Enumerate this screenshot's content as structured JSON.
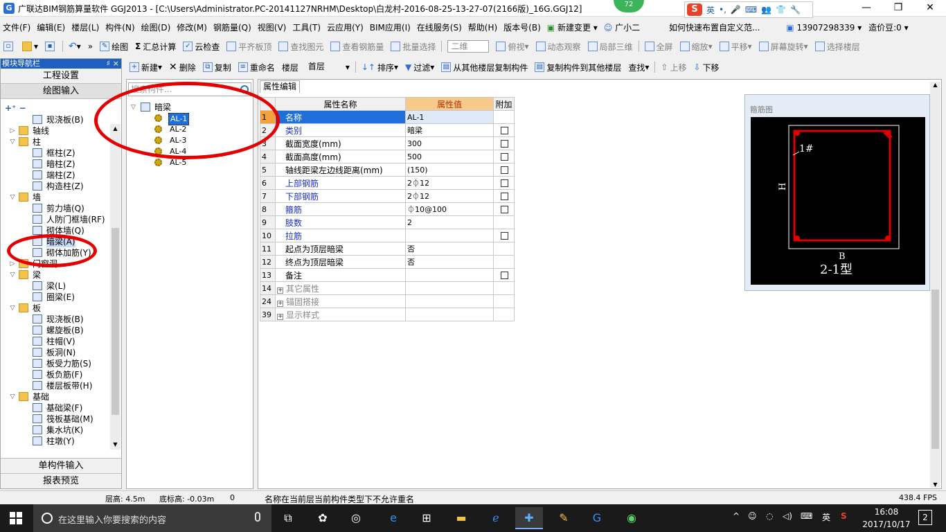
{
  "app": {
    "title": "广联达BIM钢筋算量软件 GGJ2013 - [C:\\Users\\Administrator.PC-20141127NRHM\\Desktop\\白龙村-2016-08-25-13-27-07(2166版)_16G.GGJ12]",
    "badge": "72",
    "ime_lang": "英",
    "win_buttons": [
      "—",
      "❐",
      "✕"
    ]
  },
  "menu": {
    "items": [
      "文件(F)",
      "编辑(E)",
      "楼层(L)",
      "构件(N)",
      "绘图(D)",
      "修改(M)",
      "钢筋量(Q)",
      "视图(V)",
      "工具(T)",
      "云应用(Y)",
      "BIM应用(I)",
      "在线服务(S)",
      "帮助(H)",
      "版本号(B)",
      "新建变更",
      "广小二"
    ],
    "help_link": "如何快速布置自定义范...",
    "phone": "13907298339",
    "price": "造价豆:0"
  },
  "toolbar": {
    "draw": "绘图",
    "sum": "汇总计算",
    "cloud_check": "云检查",
    "flat_top": "平齐板顶",
    "find_elem": "查找图元",
    "view_rebar": "查看钢筋量",
    "batch_select": "批量选择",
    "view2d": "二维",
    "top_view": "俯视",
    "dynamic": "动态观察",
    "local3d": "局部三维",
    "fullscreen": "全屏",
    "zoom": "缩放",
    "pan": "平移",
    "rotate": "屏幕旋转",
    "select_floor": "选择楼层"
  },
  "left_panel": {
    "title": "模块导航栏",
    "pin": "♯",
    "close": "×",
    "btn_settings": "工程设置",
    "btn_draw_input": "绘图输入",
    "btn_single": "单构件输入",
    "btn_report": "报表预览",
    "tree": [
      {
        "label": "现浇板(B)",
        "level": 2
      },
      {
        "label": "轴线",
        "level": 0,
        "folder": true,
        "collapsed": true
      },
      {
        "label": "柱",
        "level": 0,
        "folder": true
      },
      {
        "label": "框柱(Z)",
        "level": 2
      },
      {
        "label": "暗柱(Z)",
        "level": 2
      },
      {
        "label": "端柱(Z)",
        "level": 2
      },
      {
        "label": "构造柱(Z)",
        "level": 2
      },
      {
        "label": "墙",
        "level": 0,
        "folder": true
      },
      {
        "label": "剪力墙(Q)",
        "level": 2
      },
      {
        "label": "人防门框墙(RF)",
        "level": 2
      },
      {
        "label": "砌体墙(Q)",
        "level": 2
      },
      {
        "label": "暗梁(A)",
        "level": 2,
        "selected": true
      },
      {
        "label": "砌体加筋(Y)",
        "level": 2
      },
      {
        "label": "门窗洞",
        "level": 0,
        "folder": true,
        "collapsed": true
      },
      {
        "label": "梁",
        "level": 0,
        "folder": true
      },
      {
        "label": "梁(L)",
        "level": 2
      },
      {
        "label": "圈梁(E)",
        "level": 2
      },
      {
        "label": "板",
        "level": 0,
        "folder": true
      },
      {
        "label": "现浇板(B)",
        "level": 2
      },
      {
        "label": "螺旋板(B)",
        "level": 2
      },
      {
        "label": "柱帽(V)",
        "level": 2
      },
      {
        "label": "板洞(N)",
        "level": 2
      },
      {
        "label": "板受力筋(S)",
        "level": 2
      },
      {
        "label": "板负筋(F)",
        "level": 2
      },
      {
        "label": "楼层板带(H)",
        "level": 2
      },
      {
        "label": "基础",
        "level": 0,
        "folder": true
      },
      {
        "label": "基础梁(F)",
        "level": 2
      },
      {
        "label": "筏板基础(M)",
        "level": 2
      },
      {
        "label": "集水坑(K)",
        "level": 2
      },
      {
        "label": "柱墩(Y)",
        "level": 2
      }
    ]
  },
  "comp_toolbar": {
    "new": "新建",
    "delete": "删除",
    "copy": "复制",
    "rename": "重命名",
    "floor_label": "楼层",
    "floor_value": "首层",
    "sort": "排序",
    "filter": "过滤",
    "copy_from": "从其他楼层复制构件",
    "copy_to": "复制构件到其他楼层",
    "find": "查找",
    "move_up": "上移",
    "move_down": "下移"
  },
  "component_list": {
    "search_placeholder": "搜索构件...",
    "root": "暗梁",
    "items": [
      "AL-1",
      "AL-2",
      "AL-3",
      "AL-4",
      "AL-5"
    ],
    "selected": "AL-1"
  },
  "properties": {
    "tab": "属性编辑",
    "headers": [
      "属性名称",
      "属性值",
      "附加"
    ],
    "rows": [
      {
        "num": "1",
        "name": "名称",
        "value": "AL-1",
        "color": "blue",
        "check": false,
        "selected": true
      },
      {
        "num": "2",
        "name": "类别",
        "value": "暗梁",
        "color": "blue",
        "check": true
      },
      {
        "num": "3",
        "name": "截面宽度(mm)",
        "value": "300",
        "color": "black",
        "check": true
      },
      {
        "num": "4",
        "name": "截面高度(mm)",
        "value": "500",
        "color": "black",
        "check": true
      },
      {
        "num": "5",
        "name": "轴线距梁左边线距离(mm)",
        "value": "(150)",
        "color": "black",
        "check": true
      },
      {
        "num": "6",
        "name": "上部钢筋",
        "value": "2⏀12",
        "color": "blue",
        "check": true
      },
      {
        "num": "7",
        "name": "下部钢筋",
        "value": "2⏀12",
        "color": "blue",
        "check": true
      },
      {
        "num": "8",
        "name": "箍筋",
        "value": "⏀10@100",
        "color": "blue",
        "check": true
      },
      {
        "num": "9",
        "name": "肢数",
        "value": "2",
        "color": "blue",
        "check": false
      },
      {
        "num": "10",
        "name": "拉筋",
        "value": "",
        "color": "blue",
        "check": true
      },
      {
        "num": "11",
        "name": "起点为顶层暗梁",
        "value": "否",
        "color": "black",
        "check": false
      },
      {
        "num": "12",
        "name": "终点为顶层暗梁",
        "value": "否",
        "color": "black",
        "check": false
      },
      {
        "num": "13",
        "name": "备注",
        "value": "",
        "color": "black",
        "check": true
      },
      {
        "num": "14",
        "name": "其它属性",
        "value": "",
        "color": "gray",
        "check": false,
        "group": true
      },
      {
        "num": "24",
        "name": "锚固搭接",
        "value": "",
        "color": "gray",
        "check": false,
        "group": true
      },
      {
        "num": "39",
        "name": "显示样式",
        "value": "",
        "color": "gray",
        "check": false,
        "group": true
      }
    ]
  },
  "rebar_diagram": {
    "caption": "箍筋图",
    "label_1": "1#",
    "label_h": "H",
    "label_b": "B",
    "type_label": "2-1型"
  },
  "status": {
    "floor_height": "层高: 4.5m",
    "base_height": "底标高: -0.03m",
    "count": "0",
    "message": "名称在当前层当前构件类型下不允许重名",
    "fps": "438.4 FPS"
  },
  "taskbar": {
    "search_placeholder": "在这里输入你要搜索的内容",
    "ime": "英",
    "time": "16:08",
    "date": "2017/10/17",
    "notif_count": "2"
  }
}
